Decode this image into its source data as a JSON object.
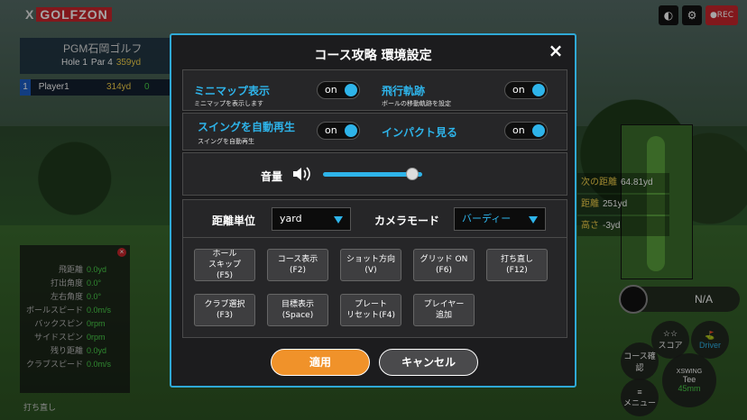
{
  "background": {
    "logo_prefix": "X",
    "logo_brand": "GOLFZON",
    "course_name": "PGM石岡ゴルフ",
    "hole": "Hole 1",
    "par": "Par 4",
    "hole_distance": "359yd",
    "player": {
      "number": "1",
      "name": "Player1",
      "distance": "314yd",
      "score": "0"
    },
    "stats": [
      {
        "label": "飛距離",
        "value": "0.0yd"
      },
      {
        "label": "打出角度",
        "value": "0.0°"
      },
      {
        "label": "左右角度",
        "value": "0.0°"
      },
      {
        "label": "ボールスピード",
        "value": "0.0m/s"
      },
      {
        "label": "バックスピン",
        "value": "0rpm"
      },
      {
        "label": "サイドスピン",
        "value": "0rpm"
      },
      {
        "label": "残り距離",
        "value": "0.0yd"
      },
      {
        "label": "クラブスピード",
        "value": "0.0m/s"
      }
    ],
    "bottom_left": "打ち直し",
    "right_info": [
      {
        "label": "次の距離",
        "value": "64.81yd"
      },
      {
        "label": "距離",
        "value": "251yd"
      },
      {
        "label": "高さ",
        "value": "-3yd"
      }
    ],
    "na_label": "N/A",
    "score_button": "スコア",
    "driver_button": "Driver",
    "course_check_button": "コース確認",
    "menu_button": "メニュー",
    "tee_label": "Tee",
    "tee_value": "45mm",
    "brand_badge": "XSWING"
  },
  "modal": {
    "title": "コース攻略 環境設定",
    "close_icon": "×",
    "options": [
      {
        "label": "ミニマップ表示",
        "sub": "ミニマップを表示します",
        "state": "on"
      },
      {
        "label": "飛行軌跡",
        "sub": "ボールの移動軌跡を設定",
        "state": "on"
      },
      {
        "label": "スイングを自動再生",
        "sub": "スイングを自動再生",
        "state": "on"
      },
      {
        "label": "インパクト見る",
        "sub": "",
        "state": "on"
      }
    ],
    "volume_label": "音量",
    "volume_level": 0.9,
    "distance_unit_label": "距離単位",
    "distance_unit_value": "yard",
    "camera_mode_label": "カメラモード",
    "camera_mode_value": "バーディー",
    "function_buttons": [
      {
        "line1": "ホール",
        "line2": "スキップ",
        "line3": "(F5)"
      },
      {
        "line1": "コース表示",
        "line2": "(F2)",
        "line3": ""
      },
      {
        "line1": "ショット方向",
        "line2": "(V)",
        "line3": ""
      },
      {
        "line1": "グリッド ON",
        "line2": "(F6)",
        "line3": ""
      },
      {
        "line1": "打ち直し",
        "line2": "(F12)",
        "line3": ""
      },
      {
        "line1": "クラブ選択",
        "line2": "(F3)",
        "line3": ""
      },
      {
        "line1": "目標表示",
        "line2": "(Space)",
        "line3": ""
      },
      {
        "line1": "プレート",
        "line2": "リセット(F4)",
        "line3": ""
      },
      {
        "line1": "プレイヤー",
        "line2": "追加",
        "line3": ""
      }
    ],
    "apply_label": "適用",
    "cancel_label": "キャンセル",
    "accent_color": "#2eb4ea",
    "apply_color": "#f0922a"
  }
}
